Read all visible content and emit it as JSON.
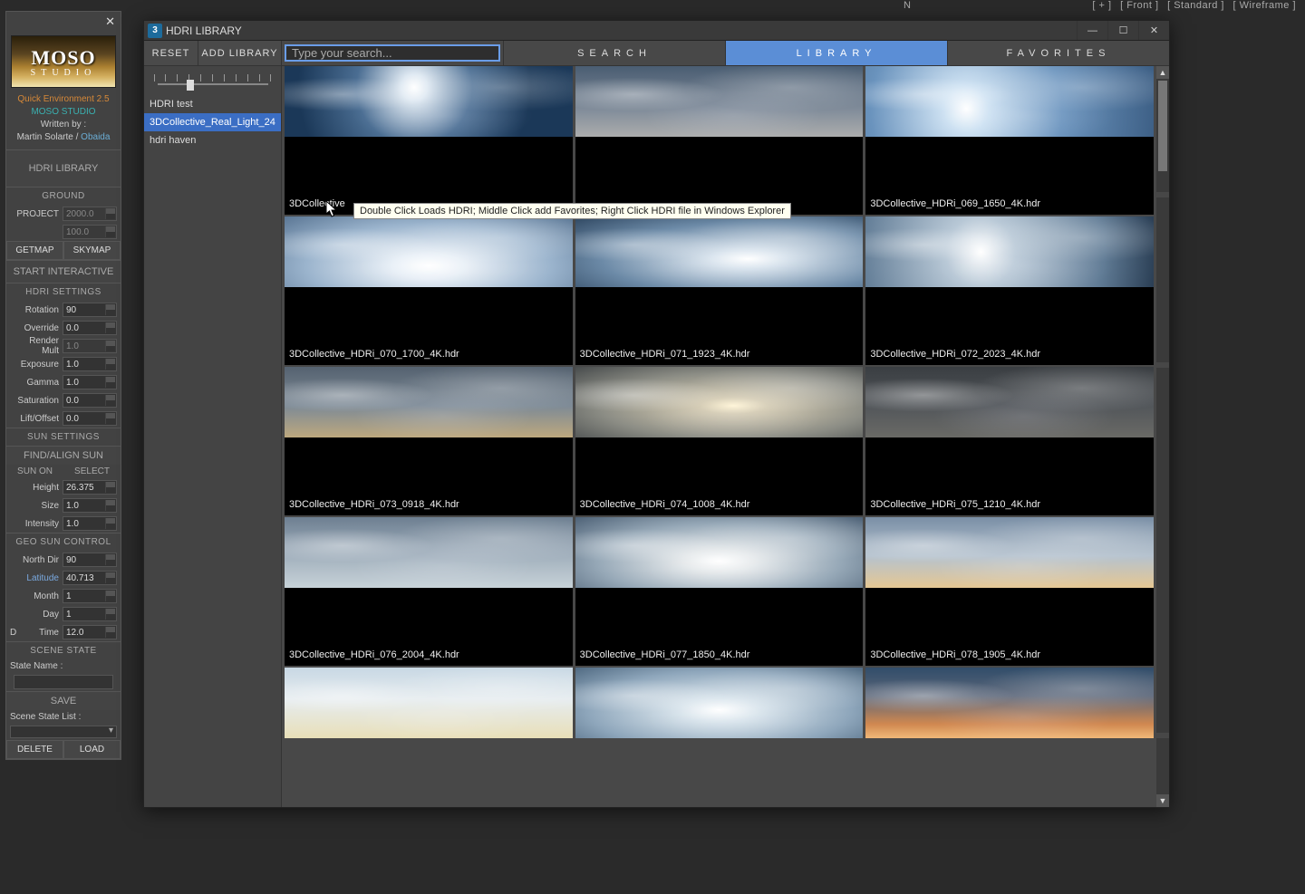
{
  "viewport": {
    "labels": [
      "[ + ]",
      "[ Front ]",
      "[ Standard ]",
      "[ Wireframe ]"
    ],
    "compass": "N"
  },
  "sidebar": {
    "logo": {
      "big": "MOSO",
      "sub": "STUDIO"
    },
    "credits": {
      "title": "Quick Environment 2.5",
      "studio": "MOSO STUDIO",
      "written": "Written by :",
      "author1": "Martin Solarte /",
      "author2": "Obaida"
    },
    "hdri_lib_btn": "HDRI LIBRARY",
    "ground_hd": "GROUND",
    "project_lbl": "PROJECT",
    "project_v1": "2000.0",
    "project_v2": "100.0",
    "getmap": "GETMAP",
    "skymap": "SKYMAP",
    "start_interactive": "START INTERACTIVE",
    "hdri_settings_hd": "HDRI SETTINGS",
    "params": [
      {
        "label": "Rotation",
        "value": "90"
      },
      {
        "label": "Override",
        "value": "0.0"
      },
      {
        "label": "Render Mult",
        "value": "1.0",
        "disabled": true
      },
      {
        "label": "Exposure",
        "value": "1.0"
      },
      {
        "label": "Gamma",
        "value": "1.0"
      },
      {
        "label": "Saturation",
        "value": "0.0"
      },
      {
        "label": "Lift/Offset",
        "value": "0.0"
      }
    ],
    "sun_settings_hd": "SUN SETTINGS",
    "find_align": "FIND/ALIGN SUN",
    "sun_on": "SUN ON",
    "select": "SELECT",
    "sun_params": [
      {
        "label": "Height",
        "value": "26.375"
      },
      {
        "label": "Size",
        "value": "1.0"
      },
      {
        "label": "Intensity",
        "value": "1.0"
      }
    ],
    "geo_hd": "GEO SUN CONTROL",
    "geo_params": [
      {
        "label": "North Dir",
        "value": "90"
      },
      {
        "label": "Latitude",
        "value": "40.713",
        "blue": true
      },
      {
        "label": "Month",
        "value": "1"
      },
      {
        "label": "Day",
        "value": "1"
      }
    ],
    "d_label": "D",
    "time_label": "Time",
    "time_value": "12.0",
    "scene_state_hd": "SCENE STATE",
    "state_name_lbl": "State Name :",
    "save": "SAVE",
    "scene_list_lbl": "Scene State List :",
    "delete": "DELETE",
    "load": "LOAD"
  },
  "hdri": {
    "window_title": "HDRI LIBRARY",
    "toolbar": {
      "reset": "RESET",
      "add_library": "ADD LIBRARY",
      "search_placeholder": "Type your search...",
      "tab_search": "SEARCH",
      "tab_library": "LIBRARY",
      "tab_favorites": "FAVORITES"
    },
    "library_list": [
      {
        "name": "HDRI test"
      },
      {
        "name": "3DCollective_Real_Light_24",
        "selected": true
      },
      {
        "name": "hdri haven"
      }
    ],
    "tooltip": "Double Click Loads HDRI;  Middle Click  add  Favorites;   Right Click HDRI file in Windows Explorer",
    "grid": [
      [
        {
          "label": "3DCollective",
          "sky": "sky-a"
        },
        {
          "label": "",
          "sky": "sky-b"
        },
        {
          "label": "3DCollective_HDRi_069_1650_4K.hdr",
          "sky": "sky-c"
        }
      ],
      [
        {
          "label": "3DCollective_HDRi_070_1700_4K.hdr",
          "sky": "sky-d"
        },
        {
          "label": "3DCollective_HDRi_071_1923_4K.hdr",
          "sky": "sky-e"
        },
        {
          "label": "3DCollective_HDRi_072_2023_4K.hdr",
          "sky": "sky-f"
        }
      ],
      [
        {
          "label": "3DCollective_HDRi_073_0918_4K.hdr",
          "sky": "sky-g"
        },
        {
          "label": "3DCollective_HDRi_074_1008_4K.hdr",
          "sky": "sky-h"
        },
        {
          "label": "3DCollective_HDRi_075_1210_4K.hdr",
          "sky": "sky-i"
        }
      ],
      [
        {
          "label": "3DCollective_HDRi_076_2004_4K.hdr",
          "sky": "sky-j"
        },
        {
          "label": "3DCollective_HDRi_077_1850_4K.hdr",
          "sky": "sky-k"
        },
        {
          "label": "3DCollective_HDRi_078_1905_4K.hdr",
          "sky": "sky-l"
        }
      ],
      [
        {
          "label": "",
          "sky": "sky-m",
          "short": true
        },
        {
          "label": "",
          "sky": "sky-n",
          "short": true
        },
        {
          "label": "",
          "sky": "sky-o",
          "short": true
        }
      ]
    ]
  }
}
